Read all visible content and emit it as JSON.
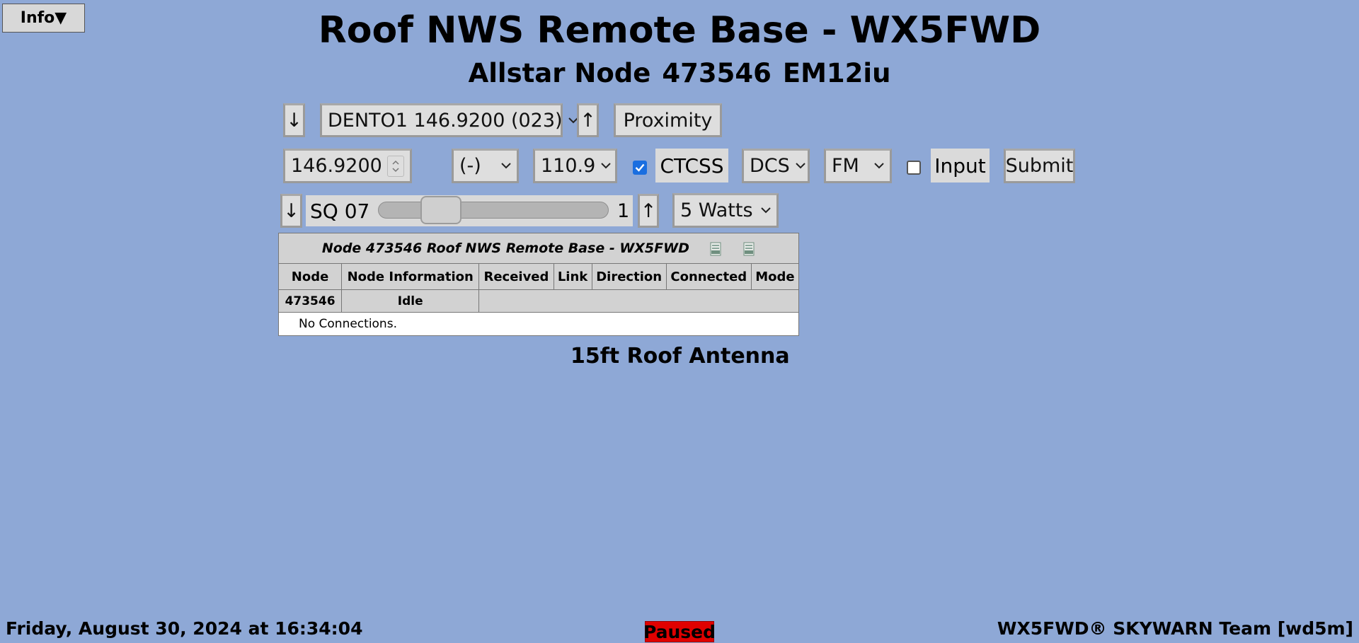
{
  "info_button": {
    "label": "Info▼"
  },
  "header": {
    "title": "Roof NWS Remote Base - WX5FWD",
    "subtitle_prefix": "Allstar Node",
    "node_number": "473546",
    "grid_square": "EM12iu"
  },
  "channel_row": {
    "down_label": "↓",
    "channel_select": "DENTO1 146.9200 (023)",
    "up_label": "↑",
    "proximity_label": "Proximity"
  },
  "tuning_row": {
    "frequency": "146.9200",
    "offset": "(-)",
    "tone": "110.9",
    "ctcss_checked": true,
    "ctcss_label": "CTCSS",
    "dcs_select": "DCS",
    "mode_select": "FM",
    "input_checked": false,
    "input_label": "Input",
    "submit_label": "Submit"
  },
  "squelch_row": {
    "down_label": "↓",
    "squelch_label": "SQ 07",
    "slider_value": 7,
    "slider_min": 0,
    "slider_max_label": "1",
    "up_label": "↑",
    "power_select": "5 Watts"
  },
  "node_table": {
    "caption": "Node 473546 Roof NWS Remote Base - WX5FWD",
    "headers": [
      "Node",
      "Node Information",
      "Received",
      "Link",
      "Direction",
      "Connected",
      "Mode"
    ],
    "node_row": {
      "node": "473546",
      "info": "Idle"
    },
    "empty_message": "No Connections."
  },
  "antenna_label": "15ft Roof Antenna",
  "footer": {
    "date_text": "Friday, August 30, 2024 at 16:34:04",
    "status": "Paused",
    "status_color": "#e00000",
    "credit": "WX5FWD® SKYWARN Team [wd5m]"
  },
  "colors": {
    "background": "#8ea8d6",
    "control": "#dedede",
    "checkbox_on": "#1a6ee0"
  }
}
